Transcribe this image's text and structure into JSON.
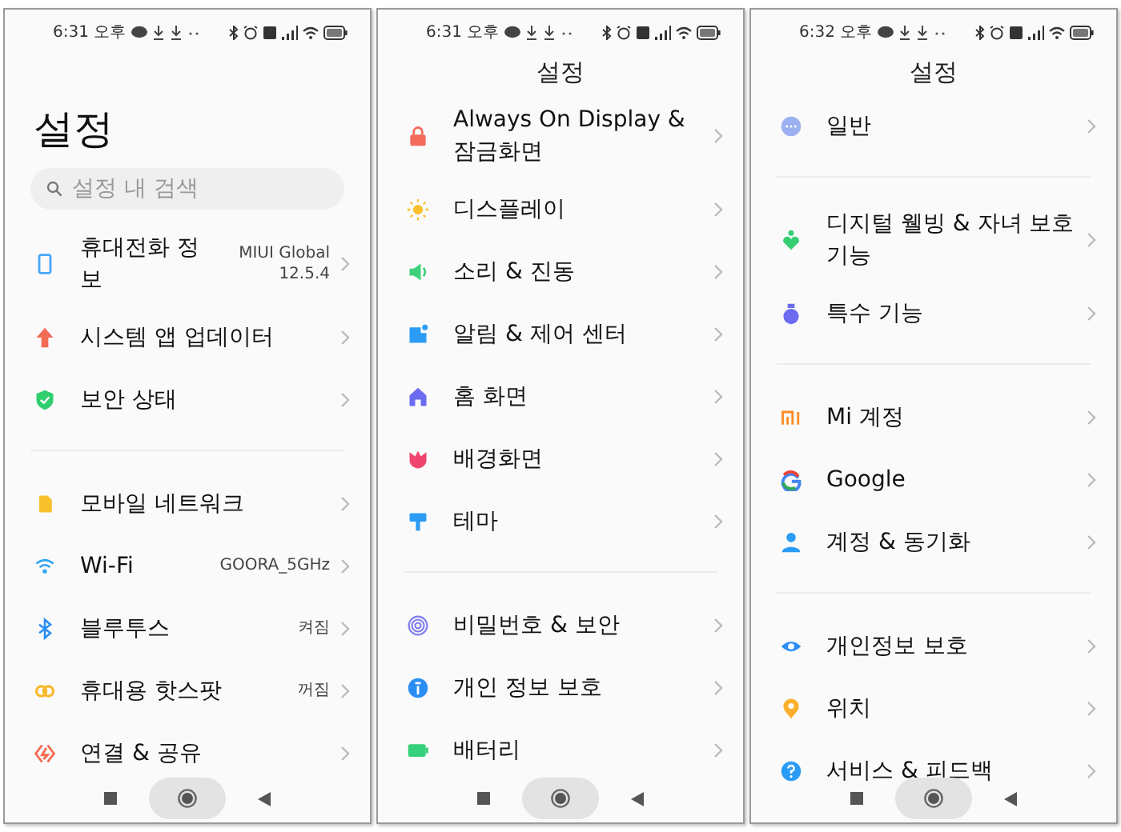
{
  "phones": [
    {
      "status_bar": {
        "time": "6:31 오후"
      },
      "header": {
        "kind": "large",
        "title": "설정"
      },
      "search": {
        "placeholder": "설정 내 검색"
      },
      "groups": [
        {
          "items": [
            {
              "label": "휴대전화 정보",
              "value": "MIUI Global 12.5.4",
              "color": "#4aa8f5"
            },
            {
              "label": "시스템 앱 업데이터",
              "color": "#f36b55"
            },
            {
              "label": "보안 상태",
              "color": "#2fcf6f"
            }
          ]
        },
        {
          "items": [
            {
              "label": "모바일 네트워크",
              "color": "#f8c12c"
            },
            {
              "label": "Wi-Fi",
              "value": "GOORA_5GHz",
              "color": "#2ba4f5"
            },
            {
              "label": "블루투스",
              "value": "켜짐",
              "color": "#2b8ef5"
            },
            {
              "label": "휴대용 핫스팟",
              "value": "꺼짐",
              "color": "#f8b82c"
            },
            {
              "label": "연결 & 공유",
              "color": "#f3694f"
            }
          ]
        }
      ]
    },
    {
      "status_bar": {
        "time": "6:31 오후"
      },
      "header": {
        "kind": "small",
        "title": "설정"
      },
      "groups": [
        {
          "items": [
            {
              "label": "Always On Display & 잠금화면",
              "color": "#f36b5a"
            },
            {
              "label": "디스플레이",
              "color": "#fbc02d"
            },
            {
              "label": "소리 & 진동",
              "color": "#3ed07a"
            },
            {
              "label": "알림 & 제어 센터",
              "color": "#2b9cf5"
            },
            {
              "label": "홈 화면",
              "color": "#6b6cf0"
            },
            {
              "label": "배경화면",
              "color": "#f0466e"
            },
            {
              "label": "테마",
              "color": "#2b9cf5"
            }
          ]
        },
        {
          "items": [
            {
              "label": "비밀번호 & 보안",
              "color": "#7f7cf0"
            },
            {
              "label": "개인 정보 보호",
              "color": "#2b8ef5"
            },
            {
              "label": "배터리",
              "color": "#35d07a"
            }
          ]
        }
      ]
    },
    {
      "status_bar": {
        "time": "6:32 오후"
      },
      "header": {
        "kind": "small",
        "title": "설정"
      },
      "groups": [
        {
          "items": [
            {
              "label": "일반",
              "color": "#9bb0f0"
            }
          ]
        },
        {
          "items": [
            {
              "label": "디지털 웰빙 & 자녀 보호 기능",
              "color": "#35cf72"
            },
            {
              "label": "특수 기능",
              "color": "#6b6cf0"
            }
          ]
        },
        {
          "items": [
            {
              "label": "Mi 계정",
              "color": "#ff8a1e"
            },
            {
              "label": "Google",
              "color": "#4285f4"
            },
            {
              "label": "계정 & 동기화",
              "color": "#2b9cf5"
            }
          ]
        },
        {
          "items": [
            {
              "label": "개인정보 보호",
              "color": "#2b8ef5"
            },
            {
              "label": "위치",
              "color": "#fbb02d"
            },
            {
              "label": "서비스 & 피드백",
              "color": "#2b9cf5"
            }
          ]
        }
      ]
    }
  ]
}
